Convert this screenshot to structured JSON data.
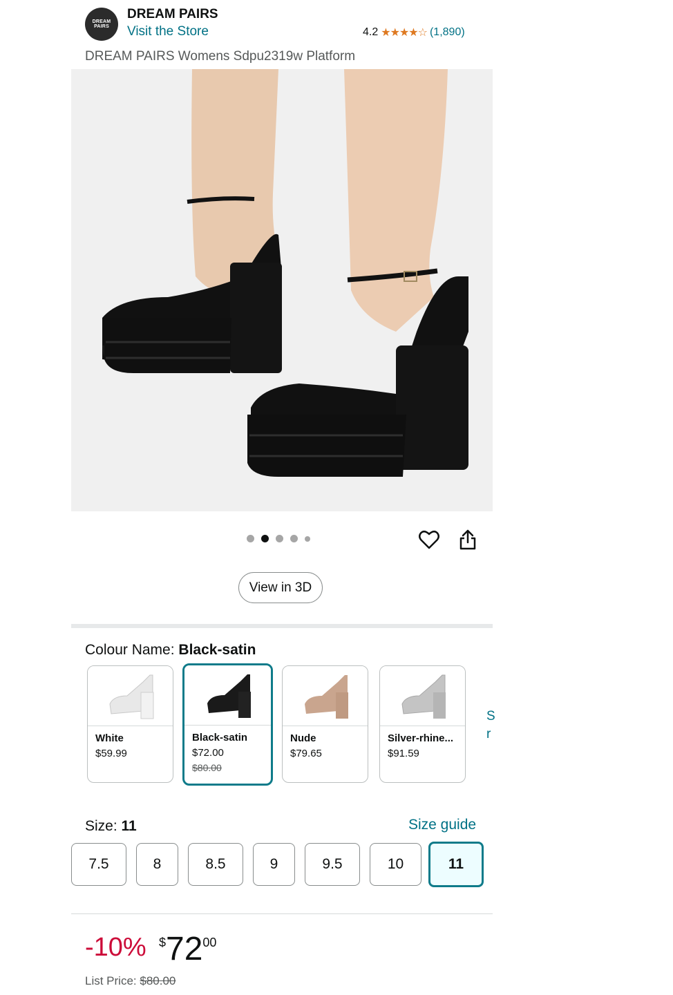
{
  "brand": {
    "logo_text": "DREAM PAIRS",
    "name": "DREAM PAIRS",
    "store_link": "Visit the Store"
  },
  "rating": {
    "value": "4.2",
    "stars": 4.2,
    "count": "(1,890)"
  },
  "product": {
    "title": "DREAM PAIRS Womens Sdpu2319w Platform"
  },
  "carousel": {
    "total_images": 5,
    "active_index": 1
  },
  "actions": {
    "heart_icon": "heart-icon",
    "share_icon": "share-icon",
    "view_3d": "View in 3D"
  },
  "colour": {
    "label": "Colour Name:",
    "selected": "Black-satin",
    "options": [
      {
        "name": "White",
        "price": "$59.99",
        "list_price": "",
        "swatch_color": "#e9e9e9"
      },
      {
        "name": "Black-satin",
        "price": "$72.00",
        "list_price": "$80.00",
        "swatch_color": "#1a1a1a"
      },
      {
        "name": "Nude",
        "price": "$79.65",
        "list_price": "",
        "swatch_color": "#c9a58e"
      },
      {
        "name": "Silver-rhine...",
        "price": "$91.59",
        "list_price": "",
        "swatch_color": "#b9b9b9"
      }
    ],
    "peek_text": [
      "S",
      "r"
    ]
  },
  "size": {
    "label": "Size:",
    "selected": "11",
    "guide": "Size guide",
    "options": [
      "7.5",
      "8",
      "8.5",
      "9",
      "9.5",
      "10",
      "11"
    ]
  },
  "price": {
    "discount": "-10%",
    "currency": "$",
    "whole": "72",
    "fraction": "00",
    "list_label": "List Price:",
    "list_value": "$80.00"
  },
  "colors": {
    "link": "#007185",
    "discount": "#cc0c39",
    "selected_border": "#0f7b8a",
    "star": "#de7921"
  }
}
